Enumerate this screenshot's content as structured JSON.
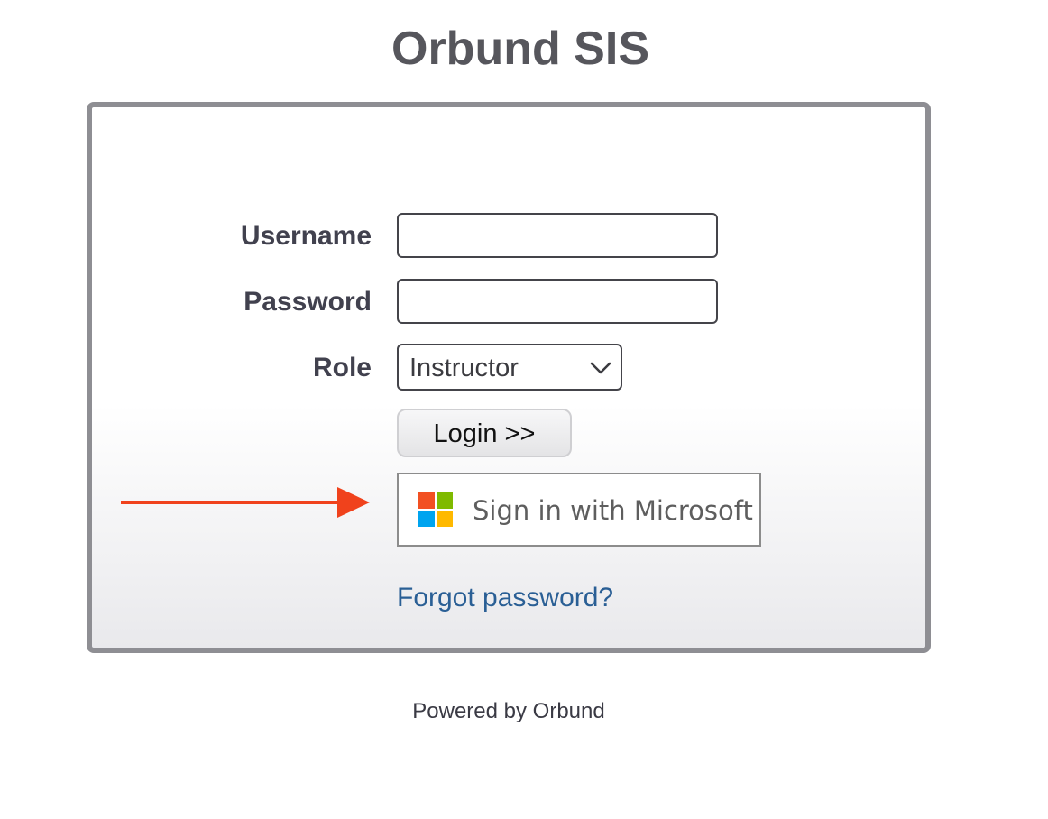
{
  "header": {
    "title": "Orbund SIS"
  },
  "login_form": {
    "username_label": "Username",
    "username_value": "",
    "password_label": "Password",
    "password_value": "",
    "role_label": "Role",
    "role_selected": "Instructor",
    "login_button_label": "Login >>",
    "microsoft_button_label": "Sign in with Microsoft",
    "forgot_password_link": "Forgot password?"
  },
  "footer": {
    "text": "Powered by Orbund"
  },
  "icons": {
    "role_dropdown": "chevron-down-icon",
    "microsoft_logo": "microsoft-logo-icon",
    "annotation": "arrow-right-icon"
  },
  "colors": {
    "title": "#56565c",
    "panel_border": "#8e8e93",
    "link": "#2a5f95",
    "annotation_arrow": "#f0421c",
    "ms_red": "#f25022",
    "ms_green": "#7fba00",
    "ms_blue": "#00a4ef",
    "ms_yellow": "#ffb900"
  }
}
